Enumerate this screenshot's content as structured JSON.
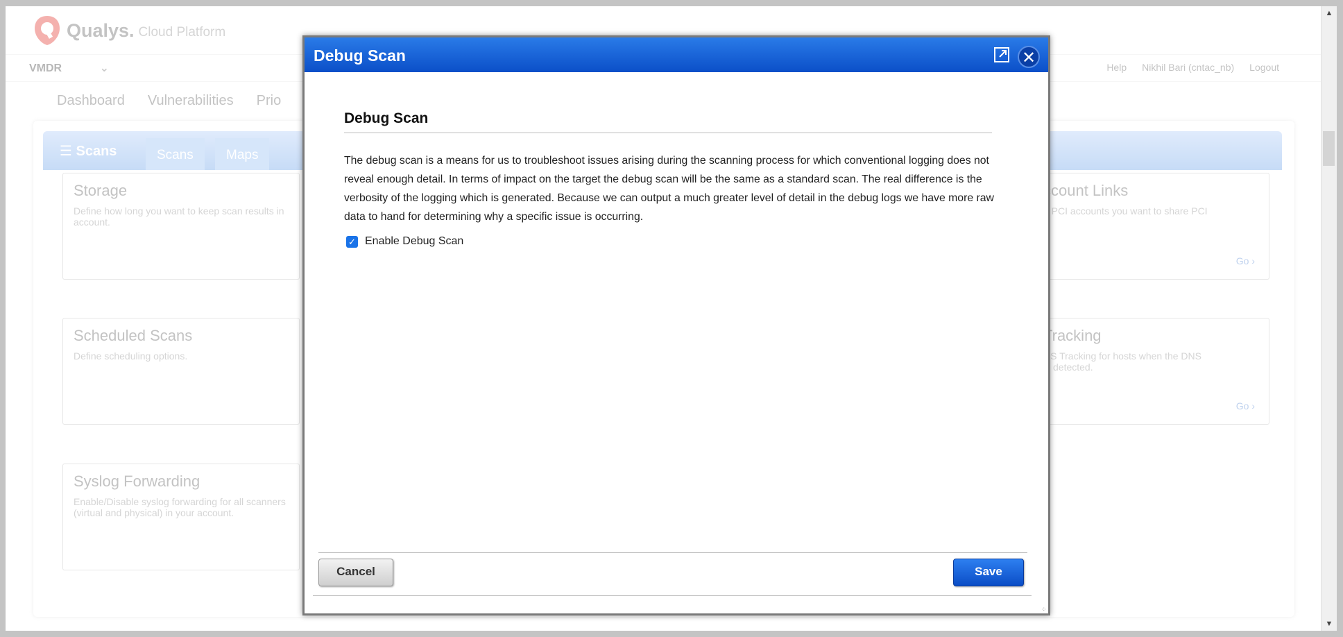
{
  "brand": {
    "name": "Qualys.",
    "platform": "Cloud Platform"
  },
  "topbar": {
    "app_selector": "VMDR",
    "help": "Help",
    "user": "Nikhil Bari (cntac_nb)",
    "logout": "Logout"
  },
  "main_tabs": [
    "Dashboard",
    "Vulnerabilities",
    "Prio"
  ],
  "panel": {
    "title": "Scans",
    "sub_tabs": [
      "Scans",
      "Maps"
    ]
  },
  "cards": {
    "storage": {
      "title": "Storage",
      "desc": "Define how long you want to keep scan results in",
      "desc2": "account."
    },
    "account_links": {
      "title": "ccount Links",
      "desc": "o PCI accounts you want to share PCI",
      "go": "Go"
    },
    "scheduled": {
      "title": "Scheduled Scans",
      "desc": "Define scheduling options."
    },
    "tracking": {
      "title": "Tracking",
      "desc": "NS Tracking for hosts when the DNS",
      "desc2": "is detected.",
      "go": "Go"
    },
    "syslog": {
      "title": "Syslog Forwarding",
      "desc": "Enable/Disable syslog forwarding for all scanners",
      "desc2": "(virtual and physical) in your account."
    }
  },
  "modal": {
    "title": "Debug Scan",
    "section_title": "Debug Scan",
    "description": "The debug scan is a means for us to troubleshoot issues arising during the scanning process for which conventional logging does not reveal enough detail. In terms of impact on the target the debug scan will be the same as a standard scan. The real difference is the verbosity of the logging which is generated. Because we can output a much greater level of detail in the debug logs we have more raw data to hand for determining why a specific issue is occurring.",
    "checkbox_label": "Enable Debug Scan",
    "cancel_label": "Cancel",
    "save_label": "Save"
  },
  "icons": {
    "close": "close-icon",
    "expand": "expand-icon",
    "checkbox": "checkbox-checked-icon",
    "list": "list-icon",
    "logo": "qualys-shield-icon"
  },
  "colors": {
    "modal_header": "#0b4fc8",
    "save_button": "#0b4dc6",
    "panel_header": "#5f9be8"
  }
}
